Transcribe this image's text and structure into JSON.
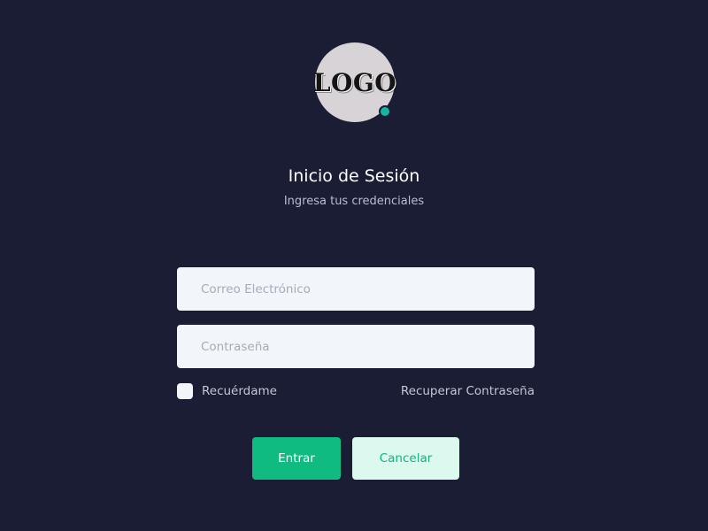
{
  "logo": {
    "text": "LOGO",
    "status": "online"
  },
  "header": {
    "title": "Inicio de Sesión",
    "subtitle": "Ingresa tus credenciales"
  },
  "form": {
    "email": {
      "placeholder": "Correo Electrónico",
      "value": ""
    },
    "password": {
      "placeholder": "Contraseña",
      "value": ""
    },
    "remember": {
      "label": "Recuérdame",
      "checked": false
    },
    "recover_link": "Recuperar Contraseña"
  },
  "actions": {
    "submit_label": "Entrar",
    "cancel_label": "Cancelar"
  },
  "colors": {
    "background": "#1a1d33",
    "primary": "#0fbb81",
    "primary_light": "#dcf9ef",
    "input_bg": "#f2f6fa",
    "status_dot": "#14b7a1",
    "logo_bg": "#d7d3d6"
  }
}
